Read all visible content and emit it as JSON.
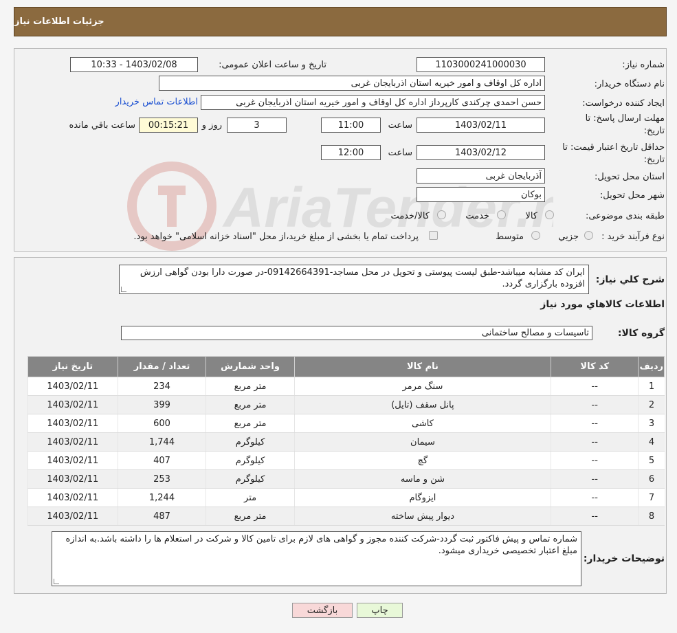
{
  "page": {
    "title": "جزئیات اطلاعات نیاز"
  },
  "info": {
    "need_number_label": "شماره نیاز:",
    "need_number": "1103000241000030",
    "announce_label": "تاریخ و ساعت اعلان عمومی:",
    "announce_value": "1403/02/08 - 10:33",
    "buyer_org_label": "نام دستگاه خریدار:",
    "buyer_org": "اداره کل اوقاف و امور خیریه استان اذربایجان غربی",
    "requester_label": "ایجاد کننده درخواست:",
    "requester": "حسن احمدی چرکندی کارپرداز اداره کل اوقاف و امور خیریه استان اذربایجان غربی",
    "contact_link": "اطلاعات تماس خریدار",
    "deadline_label_1": "مهلت ارسال پاسخ: تا",
    "deadline_label_2": "تاریخ:",
    "deadline_date": "1403/02/11",
    "time_label": "ساعت",
    "deadline_time": "11:00",
    "days_value": "3",
    "days_label": "روز و",
    "remaining_time": "00:15:21",
    "remaining_label": "ساعت باقي مانده",
    "validity_label_1": "حداقل تاریخ اعتبار قیمت: تا",
    "validity_label_2": "تاریخ:",
    "validity_date": "1403/02/12",
    "validity_time": "12:00",
    "province_label": "استان محل تحویل:",
    "province": "آذربایجان غربی",
    "city_label": "شهر محل تحویل:",
    "city": "بوکان",
    "category_label": "طبقه بندی موضوعی:",
    "category_options": [
      "کالا",
      "خدمت",
      "کالا/خدمت"
    ],
    "process_label": "نوع فرآیند خرید :",
    "process_options": [
      "جزيي",
      "متوسط"
    ],
    "process_note": "پرداخت تمام یا بخشی از مبلغ خرید،از محل \"اسناد خزانه اسلامی\" خواهد بود."
  },
  "watermark": {
    "text": "AriaTender.neT"
  },
  "description": {
    "label": "شرح کلي نياز:",
    "text": "ایران کد مشابه میباشد-طبق لیست پیوستی و تحویل در محل مساجد-09142664391-در صورت دارا بودن گواهی ارزش افزوده بارگزاری گردد."
  },
  "goods": {
    "section_title": "اطلاعات کالاهاي مورد نياز",
    "group_label": "گروه کالا:",
    "group_value": "تاسیسات و مصالح ساختمانی",
    "columns": [
      "رديف",
      "کد کالا",
      "نام کالا",
      "واحد شمارش",
      "تعداد / مقدار",
      "تاریخ نیاز"
    ],
    "rows": [
      {
        "idx": "1",
        "code": "--",
        "name": "سنگ مرمر",
        "unit": "متر مربع",
        "qty": "234",
        "date": "1403/02/11"
      },
      {
        "idx": "2",
        "code": "--",
        "name": "پانل سقف (تایل)",
        "unit": "متر مربع",
        "qty": "399",
        "date": "1403/02/11"
      },
      {
        "idx": "3",
        "code": "--",
        "name": "کاشی",
        "unit": "متر مربع",
        "qty": "600",
        "date": "1403/02/11"
      },
      {
        "idx": "4",
        "code": "--",
        "name": "سیمان",
        "unit": "کیلوگرم",
        "qty": "1,744",
        "date": "1403/02/11"
      },
      {
        "idx": "5",
        "code": "--",
        "name": "گچ",
        "unit": "کیلوگرم",
        "qty": "407",
        "date": "1403/02/11"
      },
      {
        "idx": "6",
        "code": "--",
        "name": "شن و ماسه",
        "unit": "کیلوگرم",
        "qty": "253",
        "date": "1403/02/11"
      },
      {
        "idx": "7",
        "code": "--",
        "name": "ایزوگام",
        "unit": "متر",
        "qty": "1,244",
        "date": "1403/02/11"
      },
      {
        "idx": "8",
        "code": "--",
        "name": "دیوار پیش ساخته",
        "unit": "متر مربع",
        "qty": "487",
        "date": "1403/02/11"
      }
    ]
  },
  "buyer_notes": {
    "label": "توضیحات خریدار:",
    "text": "شماره تماس و پیش فاکتور ثبت گردد-شرکت کننده مجوز و گواهی های لازم برای تامین کالا و شرکت در استعلام ها را داشته باشد.به اندازه مبلغ اعتبار تخصیصی خریداری میشود."
  },
  "buttons": {
    "print": "چاپ",
    "back": "بازگشت"
  }
}
